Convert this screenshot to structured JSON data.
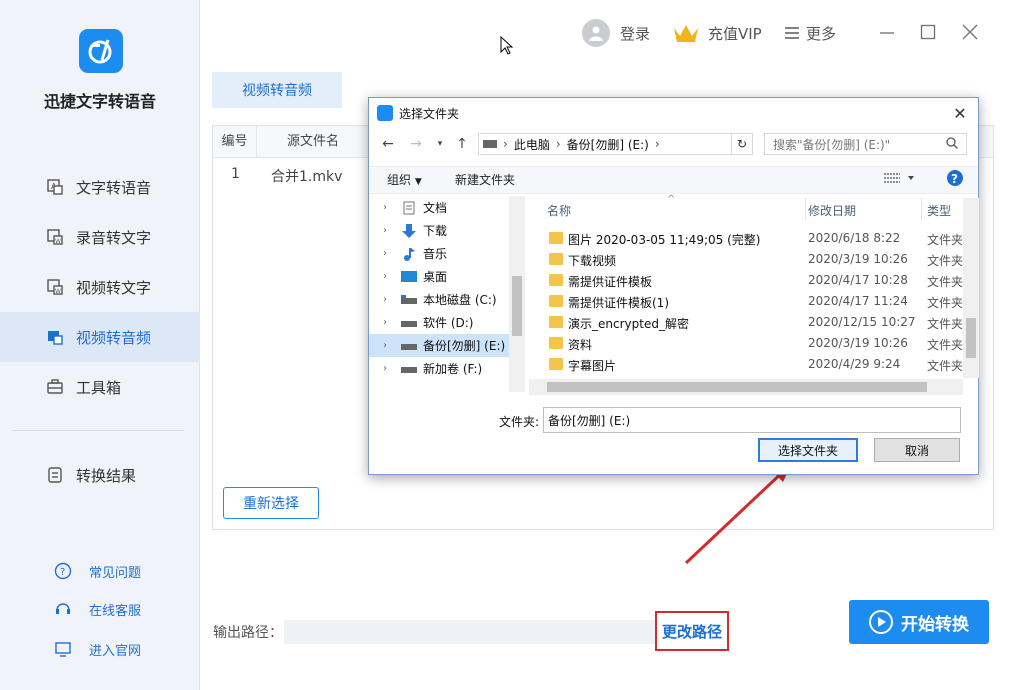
{
  "app": {
    "name": "迅捷文字转语音"
  },
  "sidebar": {
    "items": [
      {
        "label": "文字转语音"
      },
      {
        "label": "录音转文字"
      },
      {
        "label": "视频转文字"
      },
      {
        "label": "视频转音频"
      },
      {
        "label": "工具箱"
      }
    ],
    "result": {
      "label": "转换结果"
    },
    "help": [
      {
        "label": "常见问题"
      },
      {
        "label": "在线客服"
      },
      {
        "label": "进入官网"
      }
    ]
  },
  "topbar": {
    "login": "登录",
    "vip": "充值VIP",
    "more": "更多"
  },
  "colors": {
    "accent": "#1c8cf0",
    "highlight_red": "#d42c2c",
    "vip_gold": "#f1b51c"
  },
  "main": {
    "tab": "视频转音频",
    "table": {
      "headers": [
        "编号",
        "源文件名"
      ],
      "rows": [
        {
          "num": "1",
          "name": "合并1.mkv"
        }
      ]
    },
    "reselect": "重新选择",
    "output_label": "输出路径：",
    "change_path": "更改路径",
    "start": "开始转换"
  },
  "dialog": {
    "title": "选择文件夹",
    "breadcrumb": [
      "此电脑",
      "备份[勿删] (E:)"
    ],
    "search_placeholder": "搜索\"备份[勿删] (E:)\"",
    "organize": "组织",
    "new_folder": "新建文件夹",
    "tree": [
      {
        "label": "文档",
        "icon": "document-icon"
      },
      {
        "label": "下载",
        "icon": "download-icon"
      },
      {
        "label": "音乐",
        "icon": "music-icon"
      },
      {
        "label": "桌面",
        "icon": "desktop-icon"
      },
      {
        "label": "本地磁盘 (C:)",
        "icon": "drive-icon"
      },
      {
        "label": "软件 (D:)",
        "icon": "drive-icon"
      },
      {
        "label": "备份[勿删] (E:)",
        "icon": "drive-icon",
        "selected": true
      },
      {
        "label": "新加卷 (F:)",
        "icon": "drive-icon"
      }
    ],
    "columns": {
      "name": "名称",
      "date": "修改日期",
      "type": "类型"
    },
    "files": [
      {
        "name": "图片 2020-03-05 11;49;05 (完整)",
        "date": "2020/6/18 8:22",
        "type": "文件夹"
      },
      {
        "name": "下载视频",
        "date": "2020/3/19 10:26",
        "type": "文件夹"
      },
      {
        "name": "需提供证件模板",
        "date": "2020/4/17 10:28",
        "type": "文件夹"
      },
      {
        "name": "需提供证件模板(1)",
        "date": "2020/4/17 11:24",
        "type": "文件夹"
      },
      {
        "name": "演示_encrypted_解密",
        "date": "2020/12/15 10:27",
        "type": "文件夹"
      },
      {
        "name": "资料",
        "date": "2020/3/19 10:26",
        "type": "文件夹"
      },
      {
        "name": "字幕图片",
        "date": "2020/4/29 9:24",
        "type": "文件夹"
      }
    ],
    "folder_label": "文件夹:",
    "folder_value": "备份[勿删] (E:)",
    "select_button": "选择文件夹",
    "cancel_button": "取消"
  }
}
